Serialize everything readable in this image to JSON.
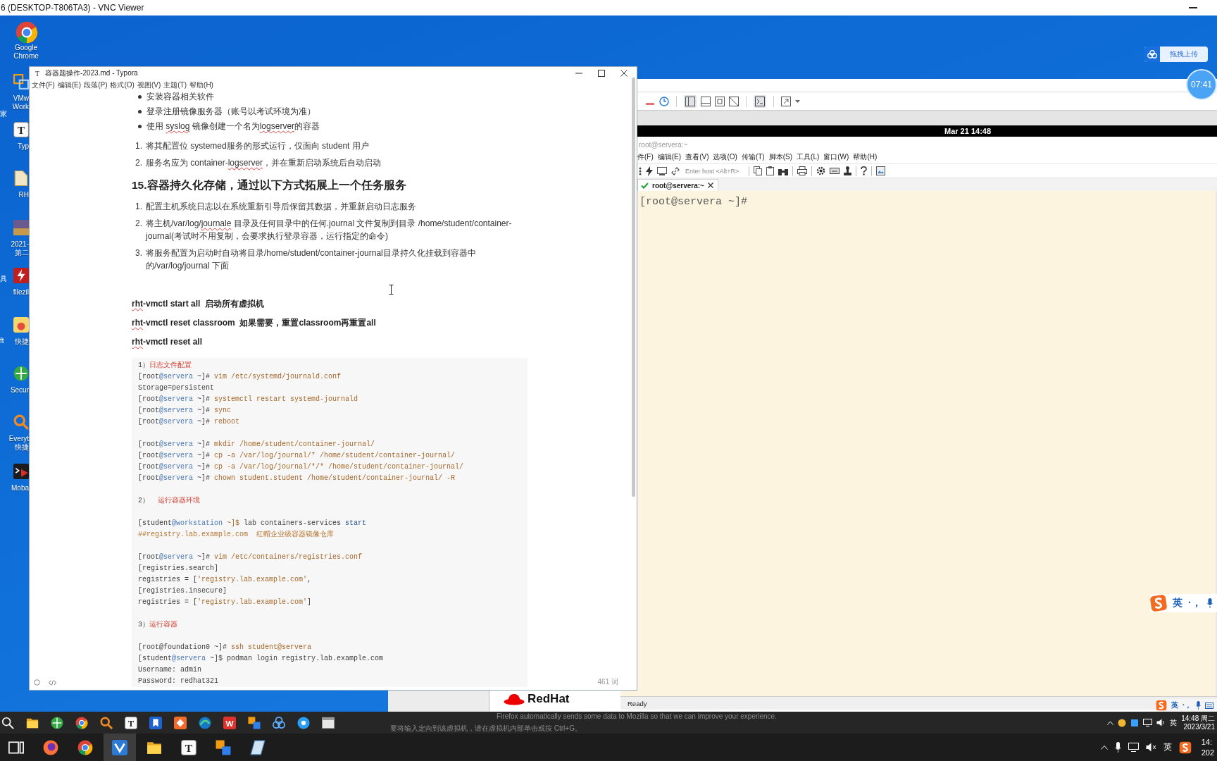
{
  "vnc_viewer": {
    "title": "6 (DESKTOP-T806TA3) - VNC Viewer"
  },
  "desktop": {
    "icons": [
      {
        "kind": "browser",
        "lines": [
          "Google",
          "Chrome"
        ]
      },
      {
        "kind": "squares",
        "lines": [
          "VMw",
          "Work"
        ]
      },
      {
        "kind": "typora",
        "glyph": "T",
        "lines": [
          "Typ"
        ]
      },
      {
        "kind": "document",
        "lines": [
          "RH"
        ]
      },
      {
        "kind": "picture",
        "lines": [
          "2021-",
          "第二"
        ]
      },
      {
        "kind": "filezilla",
        "lines": [
          "filezil"
        ]
      },
      {
        "kind": "bunny",
        "lines": [
          "快捷"
        ]
      },
      {
        "kind": "globe",
        "lines": [
          "Secur"
        ]
      },
      {
        "kind": "magnifier",
        "lines": [
          "Everyt",
          "快捷"
        ]
      },
      {
        "kind": "terminal",
        "lines": [
          "Moba"
        ]
      }
    ],
    "edge_labels": [
      "家",
      "具",
      "ft"
    ],
    "upload_button": {
      "label": "拖拽上传"
    },
    "timer": "07:41"
  },
  "typora": {
    "title": "容器题操作-2023.md - Typora",
    "app_glyph": "T",
    "menu": [
      "文件(F)",
      "编辑(E)",
      "段落(P)",
      "格式(O)",
      "视图(V)",
      "主题(T)",
      "帮助(H)"
    ],
    "blocks": [
      {
        "kind": "bullet",
        "segments": [
          {
            "text": "安装容器相关软件",
            "misspelled": false
          }
        ]
      },
      {
        "kind": "bullet",
        "segments": [
          {
            "text": "登录注册镜像服务器（账号以考试环境为准）",
            "misspelled": false
          }
        ]
      },
      {
        "kind": "bullet",
        "segments": [
          {
            "text": "使用 ",
            "misspelled": false
          },
          {
            "text": "syslog",
            "misspelled": true
          },
          {
            "text": " 镜像创建一个名为",
            "misspelled": false
          },
          {
            "text": "logserver",
            "misspelled": true
          },
          {
            "text": "的容器",
            "misspelled": false
          }
        ]
      },
      {
        "kind": "numbered",
        "number": "1.",
        "segments": [
          {
            "text": "将其配置位 systemed服务的形式运行，仅面向 student 用户",
            "misspelled": false
          }
        ]
      },
      {
        "kind": "numbered",
        "number": "2.",
        "segments": [
          {
            "text": "服务名应为 container-",
            "misspelled": false
          },
          {
            "text": "logserver",
            "misspelled": true
          },
          {
            "text": "，并在重新启动系统后自动启动",
            "misspelled": false
          }
        ]
      },
      {
        "kind": "heading",
        "segments": [
          {
            "text": "15.容器持久化存储，通过以下方式拓展上一个任务服务",
            "misspelled": false
          }
        ]
      },
      {
        "kind": "numbered",
        "number": "1.",
        "segments": [
          {
            "text": "配置主机系统日志以在系统重新引导后保留其数据，并重新启动日志服务",
            "misspelled": false
          }
        ]
      },
      {
        "kind": "numbered",
        "number": "2.",
        "segments": [
          {
            "text": "将主机/var/log/",
            "misspelled": false
          },
          {
            "text": "journale",
            "misspelled": true
          },
          {
            "text": " 目录及任何目录中的任何.journal 文件复制到目录 /home/student/container-journal(考试时不用复制，会要求执行登录容器，运行指定的命令)",
            "misspelled": false
          }
        ]
      },
      {
        "kind": "numbered",
        "number": "3.",
        "segments": [
          {
            "text": "将服务配置为启动时自动将目录/home/student/container-journal目录持久化挂载到容器中的/var/log/journal 下面",
            "misspelled": false
          }
        ]
      },
      {
        "kind": "bold",
        "segments": [
          {
            "text": "rht",
            "misspelled": true
          },
          {
            "text": "-vmctl start all  启动所有虚拟机",
            "misspelled": false
          }
        ]
      },
      {
        "kind": "bold",
        "segments": [
          {
            "text": "rht",
            "misspelled": true
          },
          {
            "text": "-vmctl reset classroom  如果需要，重置classroom再重置all",
            "misspelled": false
          }
        ]
      },
      {
        "kind": "bold",
        "segments": [
          {
            "text": "rht",
            "misspelled": true
          },
          {
            "text": "-vmctl reset all",
            "misspelled": false
          }
        ]
      }
    ],
    "code_groups": [
      {
        "lines": [
          [
            {
              "text": "1）",
              "kind": "plain"
            },
            {
              "text": "日志文件配置",
              "kind": "note"
            }
          ],
          [
            {
              "text": "[root",
              "kind": "plain"
            },
            {
              "text": "@servera",
              "kind": "host"
            },
            {
              "text": " ~]#",
              "kind": "plain"
            },
            {
              "text": " vim /etc/systemd/journald.conf",
              "kind": "command"
            }
          ],
          [
            {
              "text": "Storage=persistent",
              "kind": "plain"
            }
          ],
          [
            {
              "text": "[root",
              "kind": "plain"
            },
            {
              "text": "@servera",
              "kind": "host"
            },
            {
              "text": " ~]#",
              "kind": "plain"
            },
            {
              "text": " systemctl restart systemd-journald",
              "kind": "command"
            }
          ],
          [
            {
              "text": "[root",
              "kind": "plain"
            },
            {
              "text": "@servera",
              "kind": "host"
            },
            {
              "text": " ~]#",
              "kind": "plain"
            },
            {
              "text": " sync",
              "kind": "command"
            }
          ],
          [
            {
              "text": "[root",
              "kind": "plain"
            },
            {
              "text": "@servera",
              "kind": "host"
            },
            {
              "text": " ~]#",
              "kind": "plain"
            },
            {
              "text": " reboot",
              "kind": "command"
            }
          ]
        ]
      },
      {
        "lines": [
          [
            {
              "text": "[root",
              "kind": "plain"
            },
            {
              "text": "@servera",
              "kind": "host"
            },
            {
              "text": " ~]#",
              "kind": "plain"
            },
            {
              "text": " mkdir /home/student/container-journal/",
              "kind": "command"
            }
          ],
          [
            {
              "text": "[root",
              "kind": "plain"
            },
            {
              "text": "@servera",
              "kind": "host"
            },
            {
              "text": " ~]#",
              "kind": "plain"
            },
            {
              "text": " cp -a /var/log/journal/* /home/student/container-journal/",
              "kind": "command"
            }
          ],
          [
            {
              "text": "[root",
              "kind": "plain"
            },
            {
              "text": "@servera",
              "kind": "host"
            },
            {
              "text": " ~]#",
              "kind": "plain"
            },
            {
              "text": " cp -a /var/log/journal/*/* /home/student/container-journal/",
              "kind": "command"
            }
          ],
          [
            {
              "text": "[root",
              "kind": "plain"
            },
            {
              "text": "@servera",
              "kind": "host"
            },
            {
              "text": " ~]#",
              "kind": "plain"
            },
            {
              "text": " chown student.student /home/student/container-journal/ -R",
              "kind": "command"
            }
          ]
        ]
      },
      {
        "lines": [
          [
            {
              "text": "2）  ",
              "kind": "plain"
            },
            {
              "text": "运行容器环境",
              "kind": "note"
            }
          ]
        ]
      },
      {
        "lines": [
          [
            {
              "text": "[student",
              "kind": "plain"
            },
            {
              "text": "@workstation",
              "kind": "host"
            },
            {
              "text": " ~]$",
              "kind": "command"
            },
            {
              "text": " lab containers-services ",
              "kind": "plain"
            },
            {
              "text": "start",
              "kind": "keyword"
            }
          ],
          [
            {
              "text": "##registry.lab.example.com  红帽企业级容器镜像仓库",
              "kind": "comment"
            }
          ]
        ]
      },
      {
        "lines": [
          [
            {
              "text": "[root",
              "kind": "plain"
            },
            {
              "text": "@servera",
              "kind": "host"
            },
            {
              "text": " ~]#",
              "kind": "plain"
            },
            {
              "text": " vim /etc/containers/registries.conf",
              "kind": "command"
            }
          ],
          [
            {
              "text": "[registries.search]",
              "kind": "plain"
            }
          ],
          [
            {
              "text": "registries = [",
              "kind": "plain"
            },
            {
              "text": "'registry.lab.example.com'",
              "kind": "string"
            },
            {
              "text": ",",
              "kind": "plain"
            }
          ],
          [
            {
              "text": "[registries.insecure]",
              "kind": "plain"
            }
          ],
          [
            {
              "text": "registries = [",
              "kind": "plain"
            },
            {
              "text": "'registry.lab.example.com'",
              "kind": "string"
            },
            {
              "text": "]",
              "kind": "plain"
            }
          ]
        ]
      },
      {
        "lines": [
          [
            {
              "text": "3）",
              "kind": "plain"
            },
            {
              "text": "运行容器",
              "kind": "note"
            }
          ]
        ]
      },
      {
        "lines": [
          [
            {
              "text": "[root@foundation0 ~]#",
              "kind": "plain"
            },
            {
              "text": " ssh student@servera",
              "kind": "command"
            }
          ],
          [
            {
              "text": "[student",
              "kind": "plain"
            },
            {
              "text": "@servera",
              "kind": "host"
            },
            {
              "text": " ~]$",
              "kind": "plain"
            },
            {
              "text": " podman login registry.lab.example.com",
              "kind": "plain"
            }
          ],
          [
            {
              "text": "Username: admin",
              "kind": "plain"
            }
          ],
          [
            {
              "text": "Password: redhat321",
              "kind": "plain"
            }
          ]
        ]
      }
    ],
    "word_count": "461 词"
  },
  "vm_window": {
    "clock": "Mar 21 14:48",
    "logo_text": "RedHat",
    "xshell": {
      "title": "root@servera:~",
      "menu": [
        "件(F)",
        "编辑(E)",
        "查看(V)",
        "选项(O)",
        "传输(T)",
        "脚本(S)",
        "工具(L)",
        "窗口(W)",
        "帮助(H)"
      ],
      "host_field": {
        "placeholder": "Enter host <Alt+R>"
      },
      "tab": {
        "label": "root@servera:~",
        "connected": true
      },
      "prompt": "[root@servera ~]#",
      "status": "Ready"
    }
  },
  "ime_floating_bar": {
    "mode": "英",
    "punctuation": "·，"
  },
  "ime_toolbar": {
    "mode": "英",
    "punctuation": "·，"
  },
  "remote_taskbar": {
    "apps": [
      {
        "kind": "search"
      },
      {
        "kind": "folder"
      },
      {
        "kind": "globe"
      },
      {
        "kind": "browser"
      },
      {
        "kind": "magnifier"
      },
      {
        "kind": "typora",
        "glyph": "T"
      },
      {
        "kind": "bookmark"
      },
      {
        "kind": "tile"
      },
      {
        "kind": "edge"
      },
      {
        "kind": "wps",
        "glyph": "W"
      },
      {
        "kind": "cube"
      },
      {
        "kind": "cloud"
      },
      {
        "kind": "disc"
      },
      {
        "kind": "window"
      }
    ],
    "notices": [
      "Firefox automatically sends some data to Mozilla so that we can improve your experience.",
      "要将输入定向到该虚拟机，请在虚拟机内部单击或按 Ctrl+G。"
    ],
    "tray": {
      "lang": "英",
      "time": "14:48 周二",
      "date": "2023/3/21"
    }
  },
  "local_taskbar": {
    "apps": [
      {
        "kind": "taskview",
        "selected": false
      },
      {
        "kind": "fox",
        "selected": false
      },
      {
        "kind": "browser",
        "selected": false
      },
      {
        "kind": "vnc",
        "selected": true
      },
      {
        "kind": "folder",
        "selected": false
      },
      {
        "kind": "typora",
        "glyph": "T",
        "selected": false
      },
      {
        "kind": "cube",
        "selected": false
      },
      {
        "kind": "notes",
        "selected": false
      }
    ],
    "tray": {
      "lang": "英",
      "time": "14:",
      "date": "202"
    }
  }
}
